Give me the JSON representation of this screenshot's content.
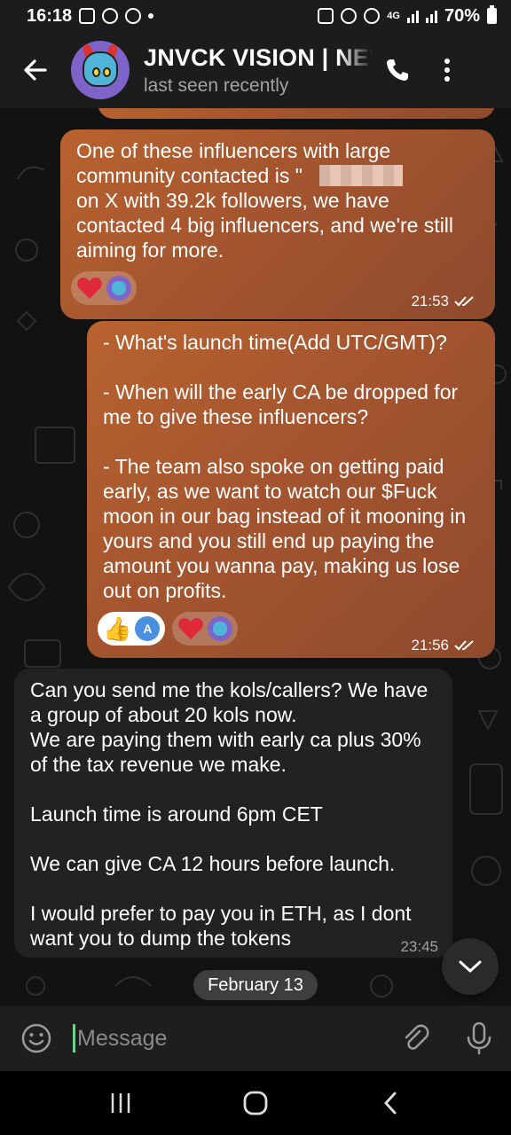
{
  "status_bar": {
    "time": "16:18",
    "network": "4G",
    "battery": "70%"
  },
  "header": {
    "title": "JNVCK VISION | NEV",
    "subtitle": "last seen recently"
  },
  "messages": [
    {
      "direction": "out",
      "text": "One of these influencers with large community contacted is \"\non X with 39.2k followers, we have contacted 4 big influencers, and we're still aiming for more.",
      "time": "21:53",
      "reactions": [
        "heart",
        "avatar"
      ]
    },
    {
      "direction": "out",
      "text": "- What's launch time(Add UTC/GMT)?\n\n- When will the early CA be dropped for me to give these influencers?\n\n- The team also spoke on getting paid early, as we want to watch our $Fuck moon in our bag instead of it mooning in yours and you still end up paying the amount you wanna pay, making us lose out on profits.",
      "time": "21:56",
      "reactions": [
        "thumbs-up",
        "A",
        "heart",
        "avatar"
      ]
    },
    {
      "direction": "in",
      "text": "Can you send me the kols/callers? We have a group of about 20 kols now.\nWe are paying them with early ca plus 30% of the tax revenue we make.\n\nLaunch time is around 6pm CET\n\nWe can give CA 12 hours before launch.\n\nI would prefer to pay you in ETH, as I dont want you to dump the tokens",
      "time": "23:45"
    }
  ],
  "date_separator": "February 13",
  "input": {
    "placeholder": "Message"
  },
  "colors": {
    "outgoing_bubble": "#a4552f",
    "incoming_bubble": "#222222",
    "background": "#121212",
    "accent": "#6fd08c"
  }
}
